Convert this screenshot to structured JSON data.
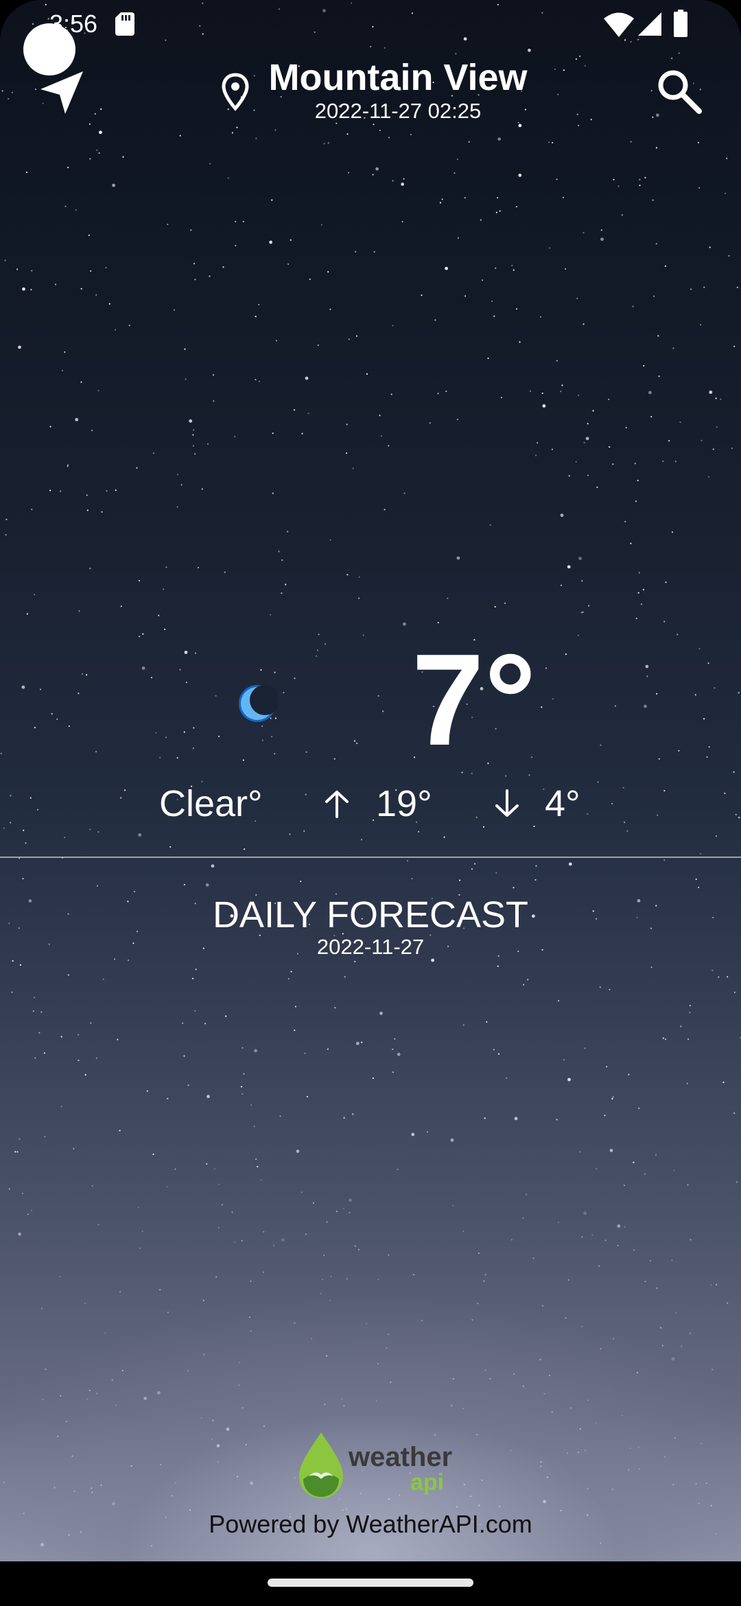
{
  "status": {
    "time": "3:56"
  },
  "header": {
    "city": "Mountain View",
    "datetime": "2022-11-27 02:25"
  },
  "current": {
    "temp": "7°",
    "condition": "Clear°",
    "high": "19°",
    "low": "4°"
  },
  "forecast": {
    "title": "DAILY FORECAST",
    "date": "2022-11-27"
  },
  "footer": {
    "logo_word1": "weather",
    "logo_word2": "api",
    "powered_by": "Powered by WeatherAPI.com"
  },
  "colors": {
    "moon": "#1565c0",
    "logo_green": "#8cc63f"
  },
  "icons": [
    "navigation-arrow-icon",
    "location-pin-icon",
    "search-icon",
    "moon-icon",
    "arrow-up-icon",
    "arrow-down-icon",
    "wifi-icon",
    "signal-icon",
    "battery-icon",
    "sd-card-icon"
  ]
}
